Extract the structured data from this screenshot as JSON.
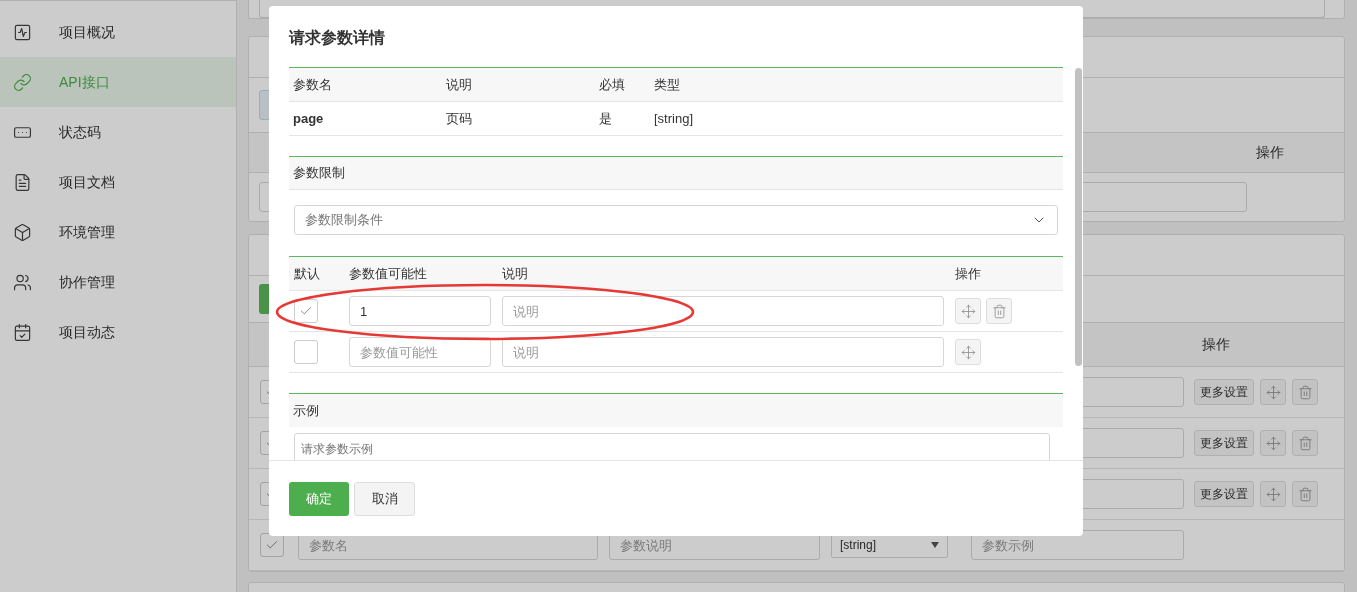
{
  "sidebar": {
    "items": [
      {
        "label": "项目概况",
        "selected": false
      },
      {
        "label": "API接口",
        "selected": true
      },
      {
        "label": "状态码",
        "selected": false
      },
      {
        "label": "项目文档",
        "selected": false
      },
      {
        "label": "环境管理",
        "selected": false
      },
      {
        "label": "协作管理",
        "selected": false
      },
      {
        "label": "项目动态",
        "selected": false
      }
    ]
  },
  "background": {
    "section_1": {
      "action_column": "操作"
    },
    "section_2": {
      "action_column": "操作",
      "rows": [
        {
          "checked": true,
          "more_button": "更多设置"
        },
        {
          "checked": true,
          "more_button": "更多设置"
        },
        {
          "checked": true,
          "more_button": "更多设置"
        },
        {
          "checked": true,
          "name_placeholder": "参数名",
          "description_placeholder": "参数说明",
          "type_value": "[string]",
          "example_placeholder": "参数示例"
        }
      ]
    }
  },
  "modal": {
    "title": "请求参数详情",
    "param_table": {
      "columns": [
        "参数名",
        "说明",
        "必填",
        "类型"
      ],
      "row": [
        "page",
        "页码",
        "是",
        "[string]"
      ]
    },
    "limits": {
      "title": "参数限制",
      "select_placeholder": "参数限制条件"
    },
    "values_table": {
      "columns": [
        "默认",
        "参数值可能性",
        "说明",
        "操作"
      ],
      "rows": [
        {
          "checked": true,
          "value": "1",
          "description_placeholder": "说明",
          "deletable": true
        },
        {
          "checked": false,
          "value": "",
          "value_placeholder": "参数值可能性",
          "description_placeholder": "说明",
          "deletable": false
        }
      ]
    },
    "example": {
      "title": "示例",
      "placeholder": "请求参数示例"
    },
    "buttons": {
      "confirm": "确定",
      "cancel": "取消"
    }
  }
}
